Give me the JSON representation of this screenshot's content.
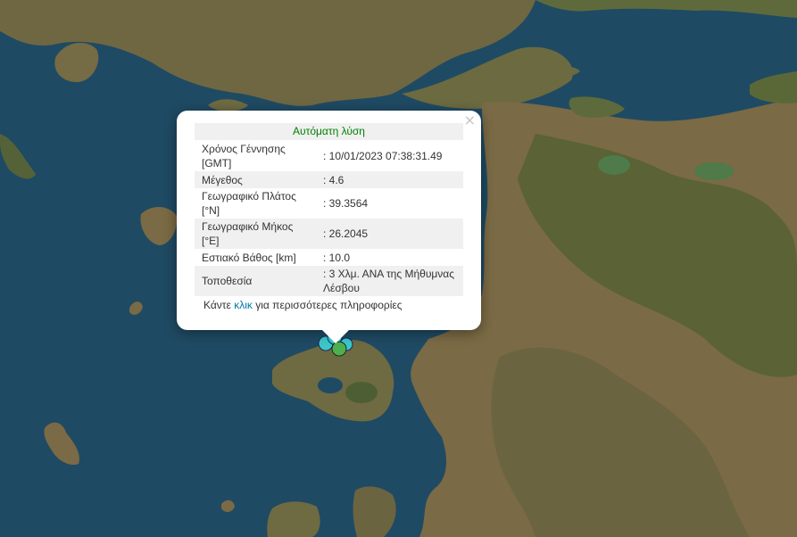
{
  "popup": {
    "title": "Αυτόματη λύση",
    "close": "×",
    "rows": [
      {
        "key": "Χρόνος Γέννησης [GMT]",
        "value": ": 10/01/2023 07:38:31.49"
      },
      {
        "key": "Μέγεθος",
        "value": ": 4.6"
      },
      {
        "key": "Γεωγραφικό Πλάτος [°N]",
        "value": ": 39.3564"
      },
      {
        "key": "Γεωγραφικό Μήκος [°E]",
        "value": ": 26.2045"
      },
      {
        "key": "Εστιακό Βάθος [km]",
        "value": ": 10.0"
      },
      {
        "key": "Τοποθεσία",
        "value": ": 3 Χλμ. ΑΝΑ της Μήθυμνας Λέσβου"
      }
    ],
    "more_prefix": "Κάντε ",
    "more_link": "κλικ",
    "more_suffix": " για περισσότερες πληροφορίες"
  },
  "colors": {
    "sea": "#1f4a63",
    "land": "#7a6a45",
    "vegetation": "#3e5a2e",
    "marker_cyan": "#3cc6c9",
    "marker_green": "#4caf50",
    "title_green": "#008000",
    "link": "#0078a8"
  },
  "icons": [
    "close-icon",
    "earthquake-marker-icon"
  ]
}
